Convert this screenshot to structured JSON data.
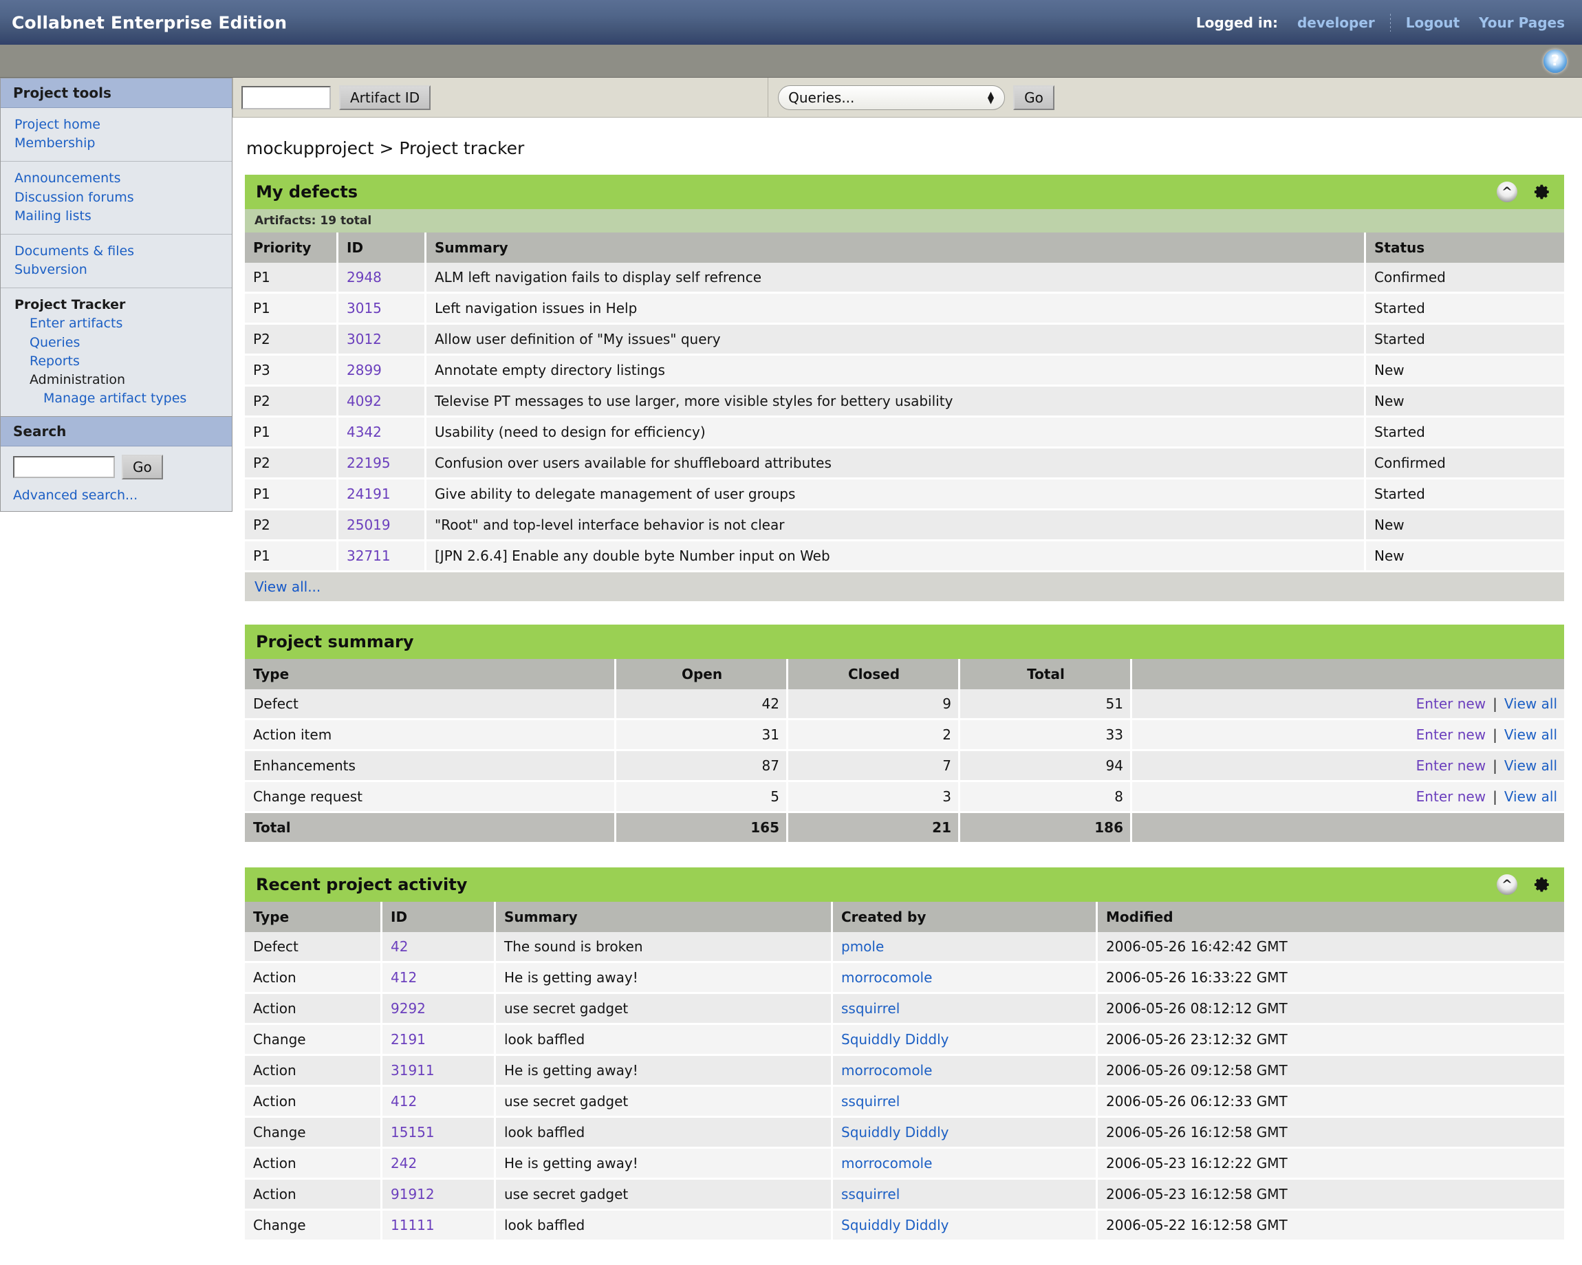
{
  "header": {
    "brand": "Collabnet Enterprise Edition",
    "logged_in_label": "Logged in:",
    "user": "developer",
    "logout": "Logout",
    "your_pages": "Your Pages",
    "help_icon": "help-icon",
    "accent_green": "#9ad053",
    "banner_blue": "#415476"
  },
  "toolbar": {
    "artifact_id_value": "",
    "artifact_id_button": "Artifact ID",
    "queries_selected": "Queries...",
    "go_button": "Go"
  },
  "sidebar": {
    "tools_title": "Project tools",
    "groups": [
      {
        "items": [
          {
            "label": "Project home",
            "type": "link"
          },
          {
            "label": "Membership",
            "type": "link"
          }
        ]
      },
      {
        "items": [
          {
            "label": "Announcements",
            "type": "link"
          },
          {
            "label": "Discussion forums",
            "type": "link"
          },
          {
            "label": "Mailing lists",
            "type": "link"
          }
        ]
      },
      {
        "items": [
          {
            "label": "Documents & files",
            "type": "link"
          },
          {
            "label": "Subversion",
            "type": "link"
          }
        ]
      },
      {
        "items": [
          {
            "label": "Project Tracker",
            "type": "head"
          },
          {
            "label": "Enter artifacts",
            "type": "sub"
          },
          {
            "label": "Queries",
            "type": "sub"
          },
          {
            "label": "Reports",
            "type": "sub"
          },
          {
            "label": "Administration",
            "type": "subhead"
          },
          {
            "label": "Manage artifact types",
            "type": "sub2"
          }
        ]
      }
    ],
    "search_title": "Search",
    "search_value": "",
    "search_go": "Go",
    "advanced_search": "Advanced search..."
  },
  "breadcrumb": "mockupproject > Project tracker",
  "my_defects": {
    "title": "My defects",
    "artifacts_total": "Artifacts: 19 total",
    "columns": [
      "Priority",
      "ID",
      "Summary",
      "Status"
    ],
    "rows": [
      {
        "priority": "P1",
        "id": "2948",
        "summary": "ALM left navigation fails to display self refrence",
        "status": "Confirmed"
      },
      {
        "priority": "P1",
        "id": "3015",
        "summary": "Left navigation issues in Help",
        "status": "Started"
      },
      {
        "priority": "P2",
        "id": "3012",
        "summary": "Allow user definition of \"My issues\" query",
        "status": "Started"
      },
      {
        "priority": "P3",
        "id": "2899",
        "summary": "Annotate empty directory listings",
        "status": "New"
      },
      {
        "priority": "P2",
        "id": "4092",
        "summary": "Televise PT messages to use larger, more visible styles for bettery usability",
        "status": "New"
      },
      {
        "priority": "P1",
        "id": "4342",
        "summary": "Usability (need to design for efficiency)",
        "status": "Started"
      },
      {
        "priority": "P2",
        "id": "22195",
        "summary": "Confusion over users available for shuffleboard attributes",
        "status": "Confirmed"
      },
      {
        "priority": "P1",
        "id": "24191",
        "summary": "Give ability to delegate management of user groups",
        "status": "Started"
      },
      {
        "priority": "P2",
        "id": "25019",
        "summary": "\"Root\" and top-level interface behavior is not clear",
        "status": "New"
      },
      {
        "priority": "P1",
        "id": "32711",
        "summary": "[JPN 2.6.4] Enable any double byte Number input on Web",
        "status": "New"
      }
    ],
    "view_all": "View all..."
  },
  "project_summary": {
    "title": "Project summary",
    "columns": [
      "Type",
      "Open",
      "Closed",
      "Total",
      ""
    ],
    "rows": [
      {
        "type": "Defect",
        "open": "42",
        "closed": "9",
        "total": "51",
        "enter_new": "Enter new",
        "view_all": "View all"
      },
      {
        "type": "Action item",
        "open": "31",
        "closed": "2",
        "total": "33",
        "enter_new": "Enter new",
        "view_all": "View all"
      },
      {
        "type": "Enhancements",
        "open": "87",
        "closed": "7",
        "total": "94",
        "enter_new": "Enter new",
        "view_all": "View all"
      },
      {
        "type": "Change request",
        "open": "5",
        "closed": "3",
        "total": "8",
        "enter_new": "Enter new",
        "view_all": "View all"
      }
    ],
    "total_row": {
      "type": "Total",
      "open": "165",
      "closed": "21",
      "total": "186"
    }
  },
  "recent_activity": {
    "title": "Recent project activity",
    "columns": [
      "Type",
      "ID",
      "Summary",
      "Created by",
      "Modified"
    ],
    "rows": [
      {
        "type": "Defect",
        "id": "42",
        "summary": "The sound is broken",
        "created_by": "pmole",
        "modified": "2006-05-26 16:42:42 GMT"
      },
      {
        "type": "Action",
        "id": "412",
        "summary": "He is getting away!",
        "created_by": "morrocomole",
        "modified": "2006-05-26 16:33:22 GMT"
      },
      {
        "type": "Action",
        "id": "9292",
        "summary": "use secret gadget",
        "created_by": "ssquirrel",
        "modified": "2006-05-26 08:12:12 GMT"
      },
      {
        "type": "Change",
        "id": "2191",
        "summary": "look baffled",
        "created_by": "Squiddly Diddly",
        "modified": "2006-05-26 23:12:32 GMT"
      },
      {
        "type": "Action",
        "id": "31911",
        "summary": "He is getting away!",
        "created_by": "morrocomole",
        "modified": "2006-05-26 09:12:58 GMT"
      },
      {
        "type": "Action",
        "id": "412",
        "summary": "use secret gadget",
        "created_by": "ssquirrel",
        "modified": "2006-05-26 06:12:33 GMT"
      },
      {
        "type": "Change",
        "id": "15151",
        "summary": "look baffled",
        "created_by": "Squiddly Diddly",
        "modified": "2006-05-26 16:12:58 GMT"
      },
      {
        "type": "Action",
        "id": "242",
        "summary": "He is getting away!",
        "created_by": "morrocomole",
        "modified": "2006-05-23 16:12:22 GMT"
      },
      {
        "type": "Action",
        "id": "91912",
        "summary": "use secret gadget",
        "created_by": "ssquirrel",
        "modified": "2006-05-23 16:12:58 GMT"
      },
      {
        "type": "Change",
        "id": "11111",
        "summary": "look baffled",
        "created_by": "Squiddly Diddly",
        "modified": "2006-05-22 16:12:58 GMT"
      }
    ]
  }
}
